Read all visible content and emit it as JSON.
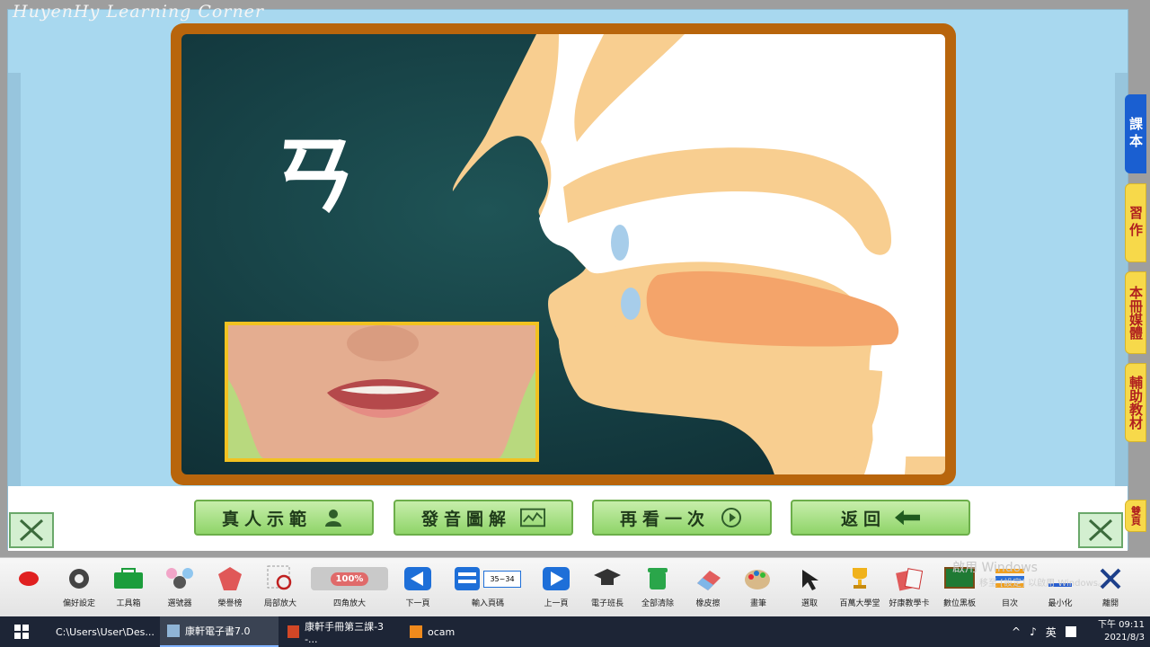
{
  "watermark": "HuyenHy Learning Corner",
  "board": {
    "zhuyin": "ㄢ"
  },
  "buttons": [
    {
      "label": "真人示範",
      "icon": "person-icon"
    },
    {
      "label": "發音圖解",
      "icon": "chart-icon"
    },
    {
      "label": "再看一次",
      "icon": "replay-icon"
    },
    {
      "label": "返回",
      "icon": "back-arrow-icon"
    }
  ],
  "side_tabs": {
    "book": "課本",
    "workbook": "習作",
    "media": "本冊媒體",
    "aux": "輔助教材",
    "double": "雙頁"
  },
  "toolbar": [
    {
      "label": "",
      "icon": "record-icon"
    },
    {
      "label": "偏好設定",
      "icon": "gear-icon"
    },
    {
      "label": "工具箱",
      "icon": "toolbox-icon"
    },
    {
      "label": "選號器",
      "icon": "selector-icon"
    },
    {
      "label": "榮譽榜",
      "icon": "honor-icon"
    },
    {
      "label": "局部放大",
      "icon": "zoom-icon"
    },
    {
      "label": "四角放大",
      "icon": "zoom-100-icon"
    },
    {
      "label": "下一頁",
      "icon": "prev-icon"
    },
    {
      "label": "輸入頁碼",
      "icon": "page-input-icon"
    },
    {
      "label": "上一頁",
      "icon": "next-icon"
    },
    {
      "label": "電子班長",
      "icon": "graduation-icon"
    },
    {
      "label": "全部清除",
      "icon": "trash-icon"
    },
    {
      "label": "橡皮擦",
      "icon": "eraser-icon"
    },
    {
      "label": "畫筆",
      "icon": "palette-icon"
    },
    {
      "label": "選取",
      "icon": "cursor-icon"
    },
    {
      "label": "百萬大學堂",
      "icon": "trophy-icon"
    },
    {
      "label": "好康教學卡",
      "icon": "cards-icon"
    },
    {
      "label": "數位黑板",
      "icon": "blackboard-icon"
    },
    {
      "label": "目次",
      "icon": "contents-icon"
    },
    {
      "label": "最小化",
      "icon": "minimize-icon"
    },
    {
      "label": "離開",
      "icon": "close-icon"
    }
  ],
  "page_input": "35~34",
  "zoom_badge": "100%",
  "activation": {
    "line1": "啟用 Windows",
    "line2": "移至 [設定] 以啟用 Windows。"
  },
  "taskbar": {
    "tasks": [
      "C:\\Users\\User\\Des...",
      "康軒電子書7.0",
      "康軒手冊第三課-3 -...",
      "ocam"
    ],
    "lang": "英",
    "time": "下午 09:11",
    "date": "2021/8/3"
  }
}
